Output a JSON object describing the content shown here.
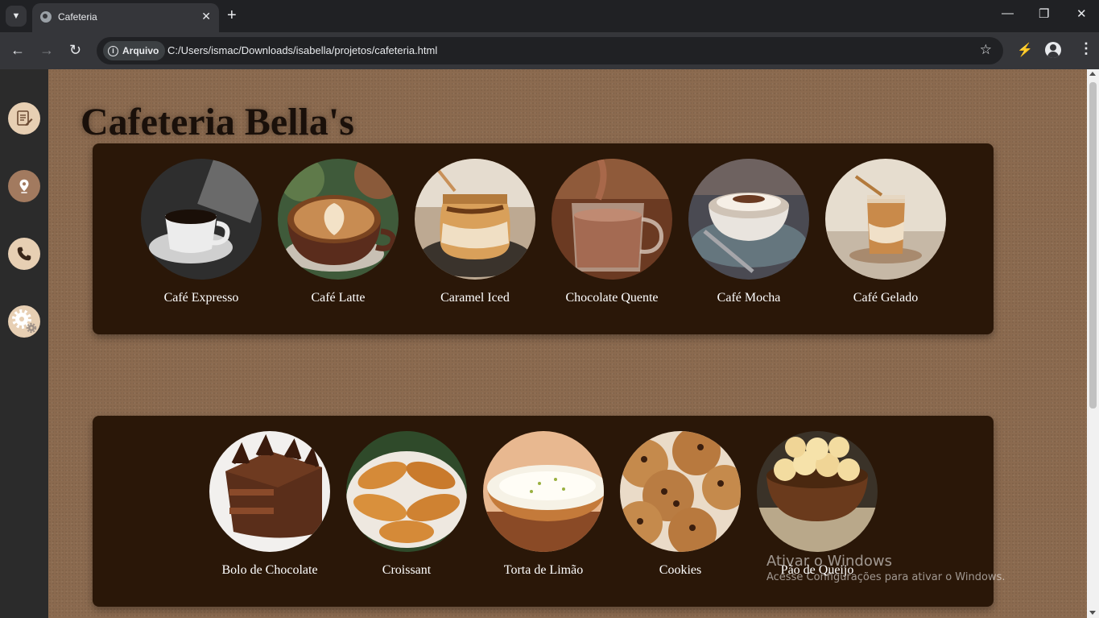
{
  "browser": {
    "tab_title": "Cafeteria",
    "chip_label": "Arquivo",
    "url": "C:/Users/ismac/Downloads/isabella/projetos/cafeteria.html"
  },
  "page": {
    "title": "Cafeteria Bella's",
    "sidebar": {
      "items": [
        {
          "icon": "menu-document-icon"
        },
        {
          "icon": "location-pin-icon"
        },
        {
          "icon": "phone-icon"
        },
        {
          "icon": "settings-gear-icon"
        }
      ]
    },
    "drinks": [
      {
        "name": "Café Expresso"
      },
      {
        "name": "Café Latte"
      },
      {
        "name": "Caramel Iced"
      },
      {
        "name": "Chocolate Quente"
      },
      {
        "name": "Café Mocha"
      },
      {
        "name": "Café Gelado"
      }
    ],
    "foods": [
      {
        "name": "Bolo de Chocolate"
      },
      {
        "name": "Croissant"
      },
      {
        "name": "Torta de Limão"
      },
      {
        "name": "Cookies"
      },
      {
        "name": "Pão de Queijo"
      }
    ]
  },
  "os_watermark": {
    "title": "Ativar o Windows",
    "subtitle": "Acesse Configurações para ativar o Windows."
  },
  "colors": {
    "panel": "#2a1708",
    "background": "#8b6a4f",
    "sidebar": "#2b2b2b",
    "sidebar_button": "#e7cfb3"
  }
}
